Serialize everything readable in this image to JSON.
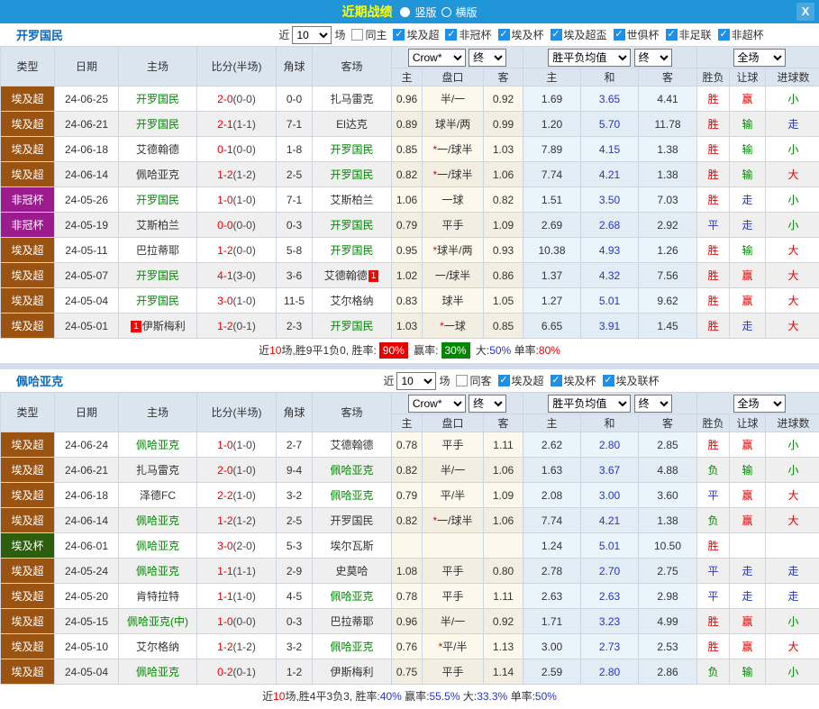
{
  "colors": {
    "titlebar": "#2095d8",
    "accent_yellow": "#ffff00",
    "team_green": "#008800",
    "red": "#e60000",
    "blue": "#2a35c0",
    "green": "#008800",
    "brown": "#9b5312",
    "purple": "#9c1b8e",
    "dark_green": "#2d5e0d"
  },
  "type_colors": {
    "埃及超": "#9b5312",
    "非冠杯": "#9c1b8e",
    "埃及杯": "#2d5e0d"
  },
  "titlebar": {
    "title": "近期战绩",
    "vertical": "竖版",
    "horizontal": "横版",
    "close": "X"
  },
  "table_header": {
    "type": "类型",
    "date": "日期",
    "home": "主场",
    "score": "比分(半场)",
    "corner": "角球",
    "away": "客场",
    "h_home": "主",
    "h_handicap": "盘口",
    "h_away": "客",
    "a_home": "主",
    "a_draw": "和",
    "a_away": "客",
    "r_result": "胜负",
    "r_let": "让球",
    "r_goals": "进球数"
  },
  "selects": {
    "odds_source": "Crow*",
    "final": "终",
    "avg": "胜平负均值",
    "full": "全场"
  },
  "sections": [
    {
      "team": "开罗国民",
      "filter": {
        "near": "近",
        "count": "10",
        "games": "场",
        "same": "同主",
        "same_checked": false,
        "leagues": [
          {
            "label": "埃及超",
            "checked": true
          },
          {
            "label": "非冠杯",
            "checked": true
          },
          {
            "label": "埃及杯",
            "checked": true
          },
          {
            "label": "埃及超盃",
            "checked": true
          },
          {
            "label": "世俱杯",
            "checked": true
          },
          {
            "label": "非足联",
            "checked": true
          },
          {
            "label": "非超杯",
            "checked": true
          }
        ]
      },
      "rows": [
        {
          "type": "埃及超",
          "date": "24-06-25",
          "home": "开罗国民",
          "hf": true,
          "score": "2-0",
          "half": "(0-0)",
          "corner": "0-0",
          "away": "扎马雷克",
          "af": false,
          "oh": "0.96",
          "hc": "半/一",
          "star": false,
          "oa": "0.92",
          "ah": "1.69",
          "ad": "3.65",
          "aa": "4.41",
          "r": "胜",
          "l": "赢",
          "g": "小"
        },
        {
          "type": "埃及超",
          "date": "24-06-21",
          "home": "开罗国民",
          "hf": true,
          "score": "2-1",
          "half": "(1-1)",
          "corner": "7-1",
          "away": "El达克",
          "af": false,
          "oh": "0.89",
          "hc": "球半/两",
          "star": false,
          "oa": "0.99",
          "ah": "1.20",
          "ad": "5.70",
          "aa": "11.78",
          "r": "胜",
          "l": "输",
          "g": "走"
        },
        {
          "type": "埃及超",
          "date": "24-06-18",
          "home": "艾德翰德",
          "hf": false,
          "score": "0-1",
          "half": "(0-0)",
          "corner": "1-8",
          "away": "开罗国民",
          "af": true,
          "oh": "0.85",
          "hc": "一/球半",
          "star": true,
          "oa": "1.03",
          "ah": "7.89",
          "ad": "4.15",
          "aa": "1.38",
          "r": "胜",
          "l": "输",
          "g": "小"
        },
        {
          "type": "埃及超",
          "date": "24-06-14",
          "home": "佩哈亚克",
          "hf": false,
          "score": "1-2",
          "half": "(1-2)",
          "corner": "2-5",
          "away": "开罗国民",
          "af": true,
          "oh": "0.82",
          "hc": "一/球半",
          "star": true,
          "oa": "1.06",
          "ah": "7.74",
          "ad": "4.21",
          "aa": "1.38",
          "r": "胜",
          "l": "输",
          "g": "大"
        },
        {
          "type": "非冠杯",
          "date": "24-05-26",
          "home": "开罗国民",
          "hf": true,
          "score": "1-0",
          "half": "(1-0)",
          "corner": "7-1",
          "away": "艾斯柏兰",
          "af": false,
          "oh": "1.06",
          "hc": "一球",
          "star": false,
          "oa": "0.82",
          "ah": "1.51",
          "ad": "3.50",
          "aa": "7.03",
          "r": "胜",
          "l": "走",
          "g": "小"
        },
        {
          "type": "非冠杯",
          "date": "24-05-19",
          "home": "艾斯柏兰",
          "hf": false,
          "score": "0-0",
          "half": "(0-0)",
          "corner": "0-3",
          "away": "开罗国民",
          "af": true,
          "oh": "0.79",
          "hc": "平手",
          "star": false,
          "oa": "1.09",
          "ah": "2.69",
          "ad": "2.68",
          "aa": "2.92",
          "r": "平",
          "l": "走",
          "g": "小"
        },
        {
          "type": "埃及超",
          "date": "24-05-11",
          "home": "巴拉蒂耶",
          "hf": false,
          "score": "1-2",
          "half": "(0-0)",
          "corner": "5-8",
          "away": "开罗国民",
          "af": true,
          "oh": "0.95",
          "hc": "球半/两",
          "star": true,
          "oa": "0.93",
          "ah": "10.38",
          "ad": "4.93",
          "aa": "1.26",
          "r": "胜",
          "l": "输",
          "g": "大"
        },
        {
          "type": "埃及超",
          "date": "24-05-07",
          "home": "开罗国民",
          "hf": true,
          "score": "4-1",
          "half": "(3-0)",
          "corner": "3-6",
          "away": "艾德翰德",
          "af": false,
          "abadge": "1",
          "oh": "1.02",
          "hc": "一/球半",
          "star": false,
          "oa": "0.86",
          "ah": "1.37",
          "ad": "4.32",
          "aa": "7.56",
          "r": "胜",
          "l": "赢",
          "g": "大"
        },
        {
          "type": "埃及超",
          "date": "24-05-04",
          "home": "开罗国民",
          "hf": true,
          "score": "3-0",
          "half": "(1-0)",
          "corner": "11-5",
          "away": "艾尔格纳",
          "af": false,
          "oh": "0.83",
          "hc": "球半",
          "star": false,
          "oa": "1.05",
          "ah": "1.27",
          "ad": "5.01",
          "aa": "9.62",
          "r": "胜",
          "l": "赢",
          "g": "大"
        },
        {
          "type": "埃及超",
          "date": "24-05-01",
          "home": "伊斯梅利",
          "hf": false,
          "hbadge": "1",
          "score": "1-2",
          "half": "(0-1)",
          "corner": "2-3",
          "away": "开罗国民",
          "af": true,
          "oh": "1.03",
          "hc": "一球",
          "star": true,
          "oa": "0.85",
          "ah": "6.65",
          "ad": "3.91",
          "aa": "1.45",
          "r": "胜",
          "l": "走",
          "g": "大"
        }
      ],
      "summary": [
        {
          "t": "近"
        },
        {
          "t": "10",
          "c": "red"
        },
        {
          "t": "场,胜9平1负0, 胜率:"
        },
        {
          "t": "90%",
          "badge": "red"
        },
        {
          "t": " 赢率:"
        },
        {
          "t": "30%",
          "badge": "green"
        },
        {
          "t": " 大:"
        },
        {
          "t": "50%",
          "c": "blue"
        },
        {
          "t": " 单率:"
        },
        {
          "t": "80%",
          "c": "red"
        }
      ]
    },
    {
      "team": "佩哈亚克",
      "filter": {
        "near": "近",
        "count": "10",
        "games": "场",
        "same": "同客",
        "same_checked": false,
        "leagues": [
          {
            "label": "埃及超",
            "checked": true
          },
          {
            "label": "埃及杯",
            "checked": true
          },
          {
            "label": "埃及联杯",
            "checked": true
          }
        ]
      },
      "rows": [
        {
          "type": "埃及超",
          "date": "24-06-24",
          "home": "佩哈亚克",
          "hf": true,
          "score": "1-0",
          "half": "(1-0)",
          "corner": "2-7",
          "away": "艾德翰德",
          "af": false,
          "oh": "0.78",
          "hc": "平手",
          "star": false,
          "oa": "1.11",
          "ah": "2.62",
          "ad": "2.80",
          "aa": "2.85",
          "r": "胜",
          "l": "赢",
          "g": "小"
        },
        {
          "type": "埃及超",
          "date": "24-06-21",
          "home": "扎马雷克",
          "hf": false,
          "score": "2-0",
          "half": "(1-0)",
          "corner": "9-4",
          "away": "佩哈亚克",
          "af": true,
          "oh": "0.82",
          "hc": "半/一",
          "star": false,
          "oa": "1.06",
          "ah": "1.63",
          "ad": "3.67",
          "aa": "4.88",
          "r": "负",
          "l": "输",
          "g": "小"
        },
        {
          "type": "埃及超",
          "date": "24-06-18",
          "home": "泽德FC",
          "hf": false,
          "score": "2-2",
          "half": "(1-0)",
          "corner": "3-2",
          "away": "佩哈亚克",
          "af": true,
          "oh": "0.79",
          "hc": "平/半",
          "star": false,
          "oa": "1.09",
          "ah": "2.08",
          "ad": "3.00",
          "aa": "3.60",
          "r": "平",
          "l": "赢",
          "g": "大"
        },
        {
          "type": "埃及超",
          "date": "24-06-14",
          "home": "佩哈亚克",
          "hf": true,
          "score": "1-2",
          "half": "(1-2)",
          "corner": "2-5",
          "away": "开罗国民",
          "af": false,
          "oh": "0.82",
          "hc": "一/球半",
          "star": true,
          "oa": "1.06",
          "ah": "7.74",
          "ad": "4.21",
          "aa": "1.38",
          "r": "负",
          "l": "赢",
          "g": "大"
        },
        {
          "type": "埃及杯",
          "date": "24-06-01",
          "home": "佩哈亚克",
          "hf": true,
          "score": "3-0",
          "half": "(2-0)",
          "corner": "5-3",
          "away": "埃尔瓦斯",
          "af": false,
          "oh": "",
          "hc": "",
          "star": false,
          "oa": "",
          "ah": "1.24",
          "ad": "5.01",
          "aa": "10.50",
          "r": "胜",
          "l": "",
          "g": ""
        },
        {
          "type": "埃及超",
          "date": "24-05-24",
          "home": "佩哈亚克",
          "hf": true,
          "score": "1-1",
          "half": "(1-1)",
          "corner": "2-9",
          "away": "史莫哈",
          "af": false,
          "oh": "1.08",
          "hc": "平手",
          "star": false,
          "oa": "0.80",
          "ah": "2.78",
          "ad": "2.70",
          "aa": "2.75",
          "r": "平",
          "l": "走",
          "g": "走"
        },
        {
          "type": "埃及超",
          "date": "24-05-20",
          "home": "肯特拉特",
          "hf": false,
          "score": "1-1",
          "half": "(1-0)",
          "corner": "4-5",
          "away": "佩哈亚克",
          "af": true,
          "oh": "0.78",
          "hc": "平手",
          "star": false,
          "oa": "1.11",
          "ah": "2.63",
          "ad": "2.63",
          "aa": "2.98",
          "r": "平",
          "l": "走",
          "g": "走"
        },
        {
          "type": "埃及超",
          "date": "24-05-15",
          "home": "佩哈亚克(中)",
          "hf": true,
          "score": "1-0",
          "half": "(0-0)",
          "corner": "0-3",
          "away": "巴拉蒂耶",
          "af": false,
          "oh": "0.96",
          "hc": "半/一",
          "star": false,
          "oa": "0.92",
          "ah": "1.71",
          "ad": "3.23",
          "aa": "4.99",
          "r": "胜",
          "l": "赢",
          "g": "小"
        },
        {
          "type": "埃及超",
          "date": "24-05-10",
          "home": "艾尔格纳",
          "hf": false,
          "score": "1-2",
          "half": "(1-2)",
          "corner": "3-2",
          "away": "佩哈亚克",
          "af": true,
          "oh": "0.76",
          "hc": "平/半",
          "star": true,
          "oa": "1.13",
          "ah": "3.00",
          "ad": "2.73",
          "aa": "2.53",
          "r": "胜",
          "l": "赢",
          "g": "大"
        },
        {
          "type": "埃及超",
          "date": "24-05-04",
          "home": "佩哈亚克",
          "hf": true,
          "score": "0-2",
          "half": "(0-1)",
          "corner": "1-2",
          "away": "伊斯梅利",
          "af": false,
          "oh": "0.75",
          "hc": "平手",
          "star": false,
          "oa": "1.14",
          "ah": "2.59",
          "ad": "2.80",
          "aa": "2.86",
          "r": "负",
          "l": "输",
          "g": "小"
        }
      ],
      "summary": [
        {
          "t": "近"
        },
        {
          "t": "10",
          "c": "red"
        },
        {
          "t": "场,胜4平3负3, 胜率:"
        },
        {
          "t": "40%",
          "c": "blue"
        },
        {
          "t": " 赢率:"
        },
        {
          "t": "55.5%",
          "c": "blue"
        },
        {
          "t": " 大:"
        },
        {
          "t": "33.3%",
          "c": "blue"
        },
        {
          "t": " 单率:"
        },
        {
          "t": "50%",
          "c": "blue"
        }
      ]
    }
  ]
}
